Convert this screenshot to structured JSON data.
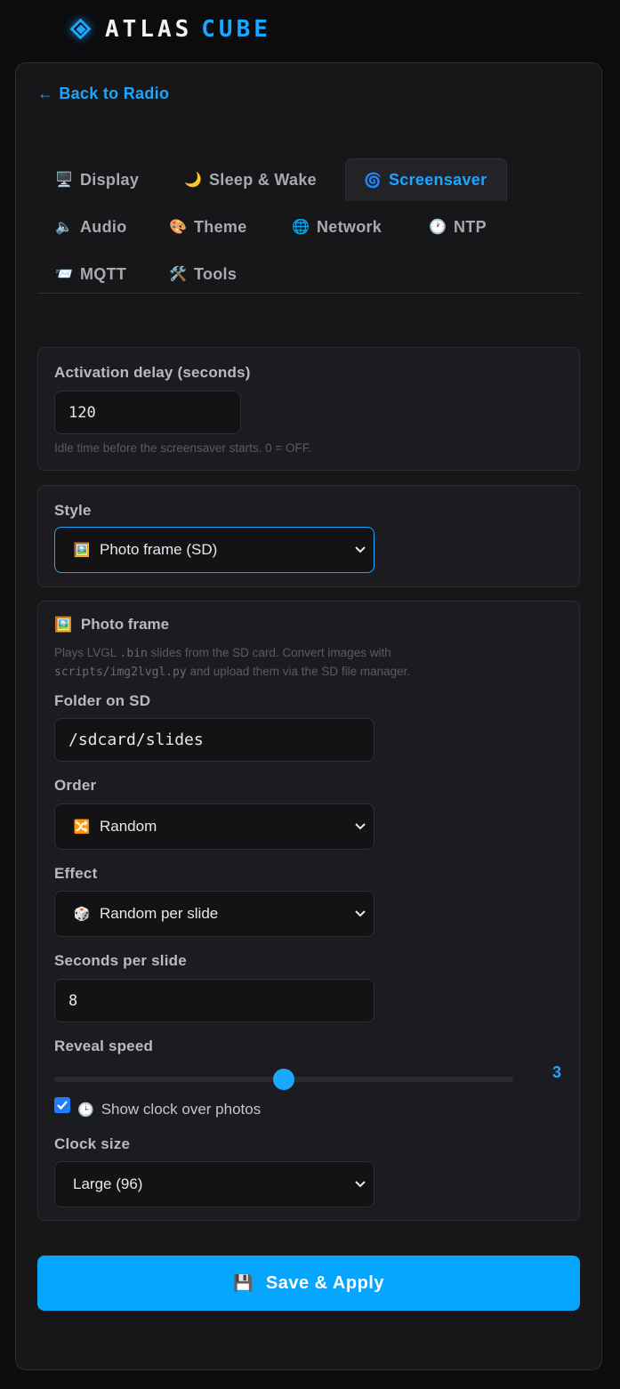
{
  "brand": {
    "word1": "ATLAS",
    "word2": "CUBE"
  },
  "nav": {
    "back_label": "Back to Radio"
  },
  "tabs": [
    {
      "icon": "🖥️",
      "label": "Display",
      "active": false
    },
    {
      "icon": "🌙",
      "label": "Sleep & Wake",
      "active": false
    },
    {
      "icon": "🌀",
      "label": "Screensaver",
      "active": true
    },
    {
      "icon": "🔈",
      "label": "Audio",
      "active": false
    },
    {
      "icon": "🎨",
      "label": "Theme",
      "active": false
    },
    {
      "icon": "🌐",
      "label": "Network",
      "active": false
    },
    {
      "icon": "🕐",
      "label": "NTP",
      "active": false
    },
    {
      "icon": "📨",
      "label": "MQTT",
      "active": false
    },
    {
      "icon": "🛠️",
      "label": "Tools",
      "active": false
    }
  ],
  "activation": {
    "label": "Activation delay (seconds)",
    "value": "120",
    "hint": "Idle time before the screensaver starts. 0 = OFF."
  },
  "style": {
    "label": "Style",
    "selected_icon": "🖼️",
    "selected": "Photo frame (SD)"
  },
  "photo_frame": {
    "title_icon": "🖼️",
    "title": "Photo frame",
    "hint_1": "Plays LVGL ",
    "hint_code_1": ".bin",
    "hint_2": " slides from the SD card. Convert images with",
    "hint_code_2": "scripts/img2lvgl.py",
    "hint_3": " and upload them via the SD file manager.",
    "folder_label": "Folder on SD",
    "folder_value": "/sdcard/slides",
    "order_label": "Order",
    "order_icon": "🔀",
    "order_value": "Random",
    "effect_label": "Effect",
    "effect_icon": "🎲",
    "effect_value": "Random per slide",
    "seconds_label": "Seconds per slide",
    "seconds_value": "8",
    "reveal_label": "Reveal speed",
    "reveal_value": "3",
    "reveal_fraction": 0.5,
    "show_clock_checked": true,
    "show_clock_icon": "🕒",
    "show_clock_label": "Show clock over photos",
    "clock_size_label": "Clock size",
    "clock_size_value": "Large (96)"
  },
  "save": {
    "icon": "💾",
    "label": "Save & Apply"
  },
  "colors": {
    "accent": "#1aa7ff",
    "background": "#0c0c0e",
    "panel": "#17171a"
  }
}
